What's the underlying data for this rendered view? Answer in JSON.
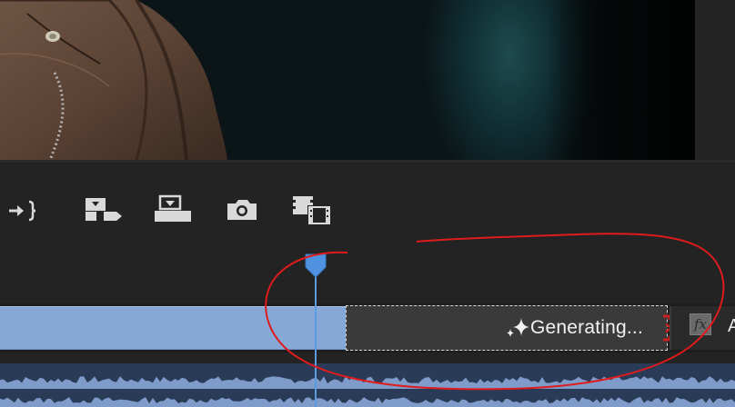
{
  "program_monitor": {},
  "toolbar": {
    "buttons": [
      {
        "name": "go-to-out-point",
        "icon": "go-to-out-icon"
      },
      {
        "name": "insert",
        "icon": "insert-icon"
      },
      {
        "name": "overwrite",
        "icon": "overwrite-icon"
      },
      {
        "name": "export-frame",
        "icon": "camera-icon"
      },
      {
        "name": "comparison-view",
        "icon": "comparison-view-icon"
      }
    ]
  },
  "timeline": {
    "generating_clip": {
      "label": "Generating..."
    },
    "next_clip": {
      "fx_label": "fx",
      "label": "A"
    }
  },
  "colors": {
    "clip_blue": "#86a8d6",
    "playhead": "#5b9be0",
    "annotation": "#e01b1b",
    "trim_handle": "#cc1f1f"
  }
}
